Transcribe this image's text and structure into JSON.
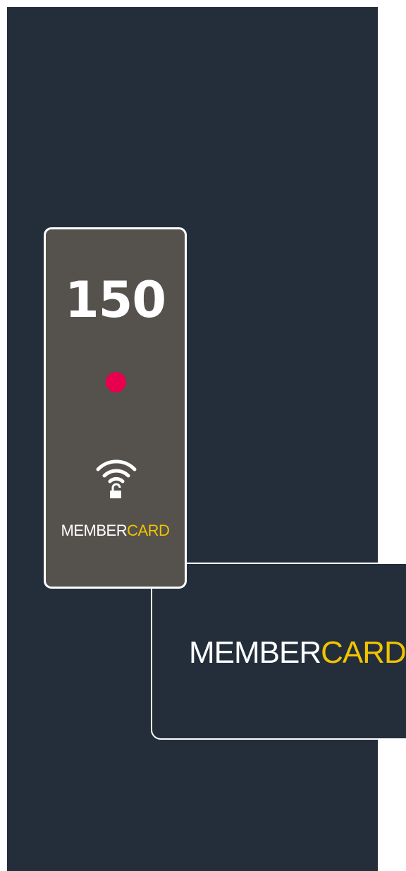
{
  "reader": {
    "room_number": "150",
    "status_color": "#e8004f",
    "icon": "nfc-unlock-icon",
    "brand_primary": "MEMBER",
    "brand_accent": "CARD"
  },
  "card": {
    "brand_primary": "MEMBER",
    "brand_accent": "CARD"
  },
  "colors": {
    "panel_background": "#232e3a",
    "reader_background": "#55514d",
    "brand_accent": "#f0c400",
    "text": "#ffffff"
  }
}
